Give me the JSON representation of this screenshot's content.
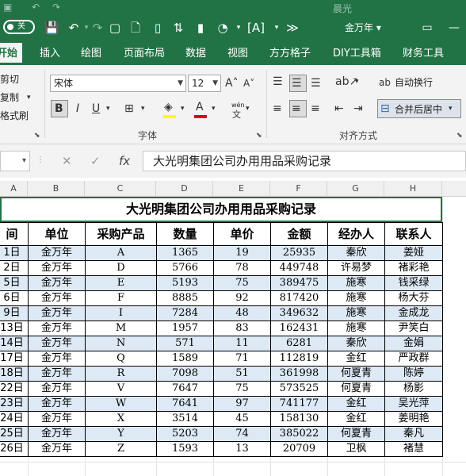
{
  "title_bar": {
    "autosave_label": "关",
    "doc_title": "金万年 ▾",
    "ghost_user": "晨光"
  },
  "ribbon_tabs": [
    "开始",
    "插入",
    "绘图",
    "页面布局",
    "数据",
    "视图",
    "方方格子",
    "DIY工具箱",
    "财务工具"
  ],
  "ribbon": {
    "clipboard": {
      "cut": "剪切",
      "copy": "复制",
      "format_painter": "格式刷"
    },
    "font": {
      "name": "宋体",
      "size": "12",
      "group_label": "字体",
      "wen_label": "wén"
    },
    "alignment": {
      "wrap_text": "自动换行",
      "merge_center": "合并后居中",
      "group_label": "对齐方式"
    }
  },
  "formula_bar": {
    "name_box": "",
    "fx_label": "fx",
    "content": "大光明集团公司办用用品采购记录"
  },
  "columns": [
    "A",
    "B",
    "C",
    "D",
    "E",
    "F",
    "G",
    "H"
  ],
  "sheet": {
    "title": "大光明集团公司办用用品采购记录",
    "headers": [
      "间",
      "单位",
      "采购产品",
      "数量",
      "单价",
      "金额",
      "经办人",
      "联系人"
    ],
    "rows": [
      [
        "1日",
        "金万年",
        "A",
        "1365",
        "19",
        "25935",
        "秦欣",
        "姜娅"
      ],
      [
        "2日",
        "金万年",
        "D",
        "5766",
        "78",
        "449748",
        "许易梦",
        "褚彩艳"
      ],
      [
        "5日",
        "金万年",
        "E",
        "5193",
        "75",
        "389475",
        "施寒",
        "钱采绿"
      ],
      [
        "6日",
        "金万年",
        "F",
        "8885",
        "92",
        "817420",
        "施寒",
        "杨大芬"
      ],
      [
        "9日",
        "金万年",
        "I",
        "7284",
        "48",
        "349632",
        "施寒",
        "金成龙"
      ],
      [
        "13日",
        "金万年",
        "M",
        "1957",
        "83",
        "162431",
        "施寒",
        "尹笑白"
      ],
      [
        "14日",
        "金万年",
        "N",
        "571",
        "11",
        "6281",
        "秦欣",
        "金娟"
      ],
      [
        "17日",
        "金万年",
        "Q",
        "1589",
        "71",
        "112819",
        "金红",
        "严政群"
      ],
      [
        "18日",
        "金万年",
        "R",
        "7098",
        "51",
        "361998",
        "何夏青",
        "陈婷"
      ],
      [
        "22日",
        "金万年",
        "V",
        "7647",
        "75",
        "573525",
        "何夏青",
        "杨影"
      ],
      [
        "23日",
        "金万年",
        "W",
        "7641",
        "97",
        "741177",
        "金红",
        "吴光萍"
      ],
      [
        "24日",
        "金万年",
        "X",
        "3514",
        "45",
        "158130",
        "金红",
        "姜明艳"
      ],
      [
        "25日",
        "金万年",
        "Y",
        "5203",
        "74",
        "385022",
        "何夏青",
        "秦凡"
      ],
      [
        "26日",
        "金万年",
        "Z",
        "1593",
        "13",
        "20709",
        "卫枫",
        "褚慧"
      ]
    ]
  },
  "colors": {
    "accent": "#217346",
    "row_alt": "#dde9f5"
  }
}
